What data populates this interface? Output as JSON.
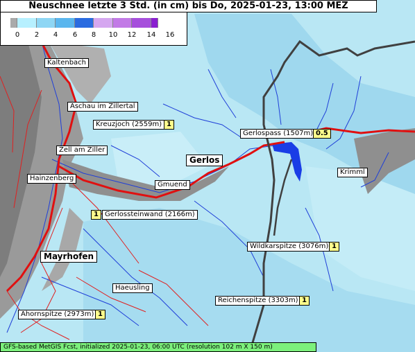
{
  "title": "Neuschnee letzte 3 Std. (in cm) bis Do, 2025-01-23, 13:00 MEZ",
  "legend": {
    "ticks": [
      "0",
      "2",
      "4",
      "6",
      "8",
      "10",
      "12",
      "14",
      "16"
    ],
    "colors": [
      "#aaaaaa",
      "#b7f0ff",
      "#8ed6f4",
      "#5ab6ee",
      "#2a6be0",
      "#d5a7f0",
      "#c27ae6",
      "#a64fdc",
      "#8a1fd0"
    ]
  },
  "places": {
    "kaltenbach": "Kaltenbach",
    "aschau": "Aschau im Zillertal",
    "kreuzjoch": "Kreuzjoch (2559m)",
    "kreuzjoch_val": "1",
    "gerlospass": "Gerlospass (1507m)",
    "gerlospass_val": "0.5",
    "zell": "Zell am Ziller",
    "gerlos": "Gerlos",
    "krimml": "Krimml",
    "hainzenberg": "Hainzenberg",
    "gmuend": "Gmuend",
    "gerlossteinwand": "Gerlossteinwand (2166m)",
    "gerlossteinwand_val": "1",
    "wildkarspitze": "Wildkarspitze (3076m)",
    "wildkarspitze_val": "1",
    "mayrhofen": "Mayrhofen",
    "haeusling": "Haeusling",
    "reichenspitze": "Reichenspitze (3303m)",
    "reichenspitze_val": "1",
    "ahornspitze": "Ahornspitze (2973m)",
    "ahornspitze_val": "1"
  },
  "footer": "GFS-based MetGIS Fcst, initialized 2025-01-23, 06:00 UTC  (resolution 102 m X 150 m)"
}
